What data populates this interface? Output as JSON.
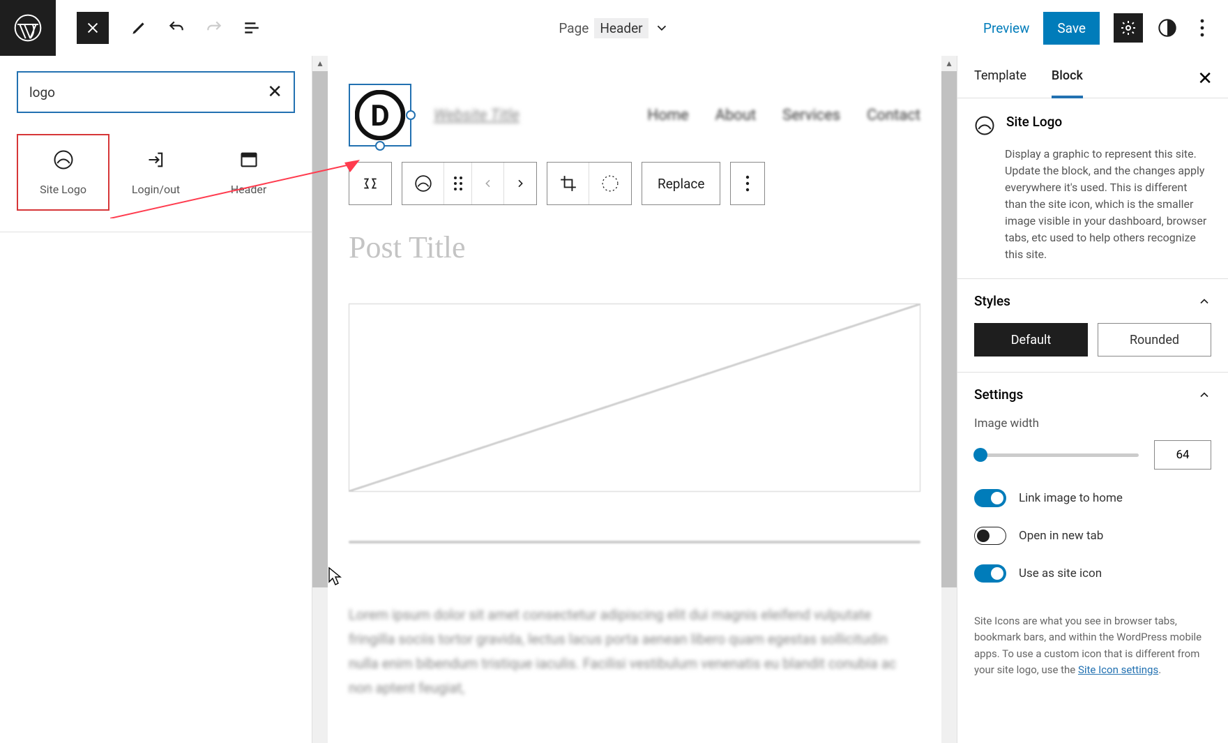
{
  "topbar": {
    "doc_type": "Page",
    "doc_part": "Header",
    "preview": "Preview",
    "save": "Save"
  },
  "left": {
    "search_value": "logo",
    "blocks": [
      {
        "label": "Site Logo"
      },
      {
        "label": "Login/out"
      },
      {
        "label": "Header"
      }
    ]
  },
  "canvas": {
    "site_title": "Website Title",
    "nav": [
      "Home",
      "About",
      "Services",
      "Contact"
    ],
    "toolbar_replace": "Replace",
    "post_title": "Post Title",
    "body_text": "Lorem ipsum dolor sit amet consectetur adipiscing elit dui magnis eleifend vulputate fringilla sociis tortor gravida, lectus lacus porta aenean libero quam egestas sollicitudin nulla enim bibendum tristique iaculis. Facilisi vestibulum venenatis eu blandit conubia ac non aptent feugiat,"
  },
  "right": {
    "tab_template": "Template",
    "tab_block": "Block",
    "block_title": "Site Logo",
    "block_desc": "Display a graphic to represent this site. Update the block, and the changes apply everywhere it's used. This is different than the site icon, which is the smaller image visible in your dashboard, browser tabs, etc used to help others recognize this site.",
    "section_styles": "Styles",
    "style_default": "Default",
    "style_rounded": "Rounded",
    "section_settings": "Settings",
    "setting_image_width": "Image width",
    "image_width_value": "64",
    "toggle_link_home": "Link image to home",
    "toggle_new_tab": "Open in new tab",
    "toggle_site_icon": "Use as site icon",
    "help_text": "Site Icons are what you see in browser tabs, bookmark bars, and within the WordPress mobile apps. To use a custom icon that is different from your site logo, use the ",
    "help_link": "Site Icon settings",
    "help_suffix": "."
  }
}
